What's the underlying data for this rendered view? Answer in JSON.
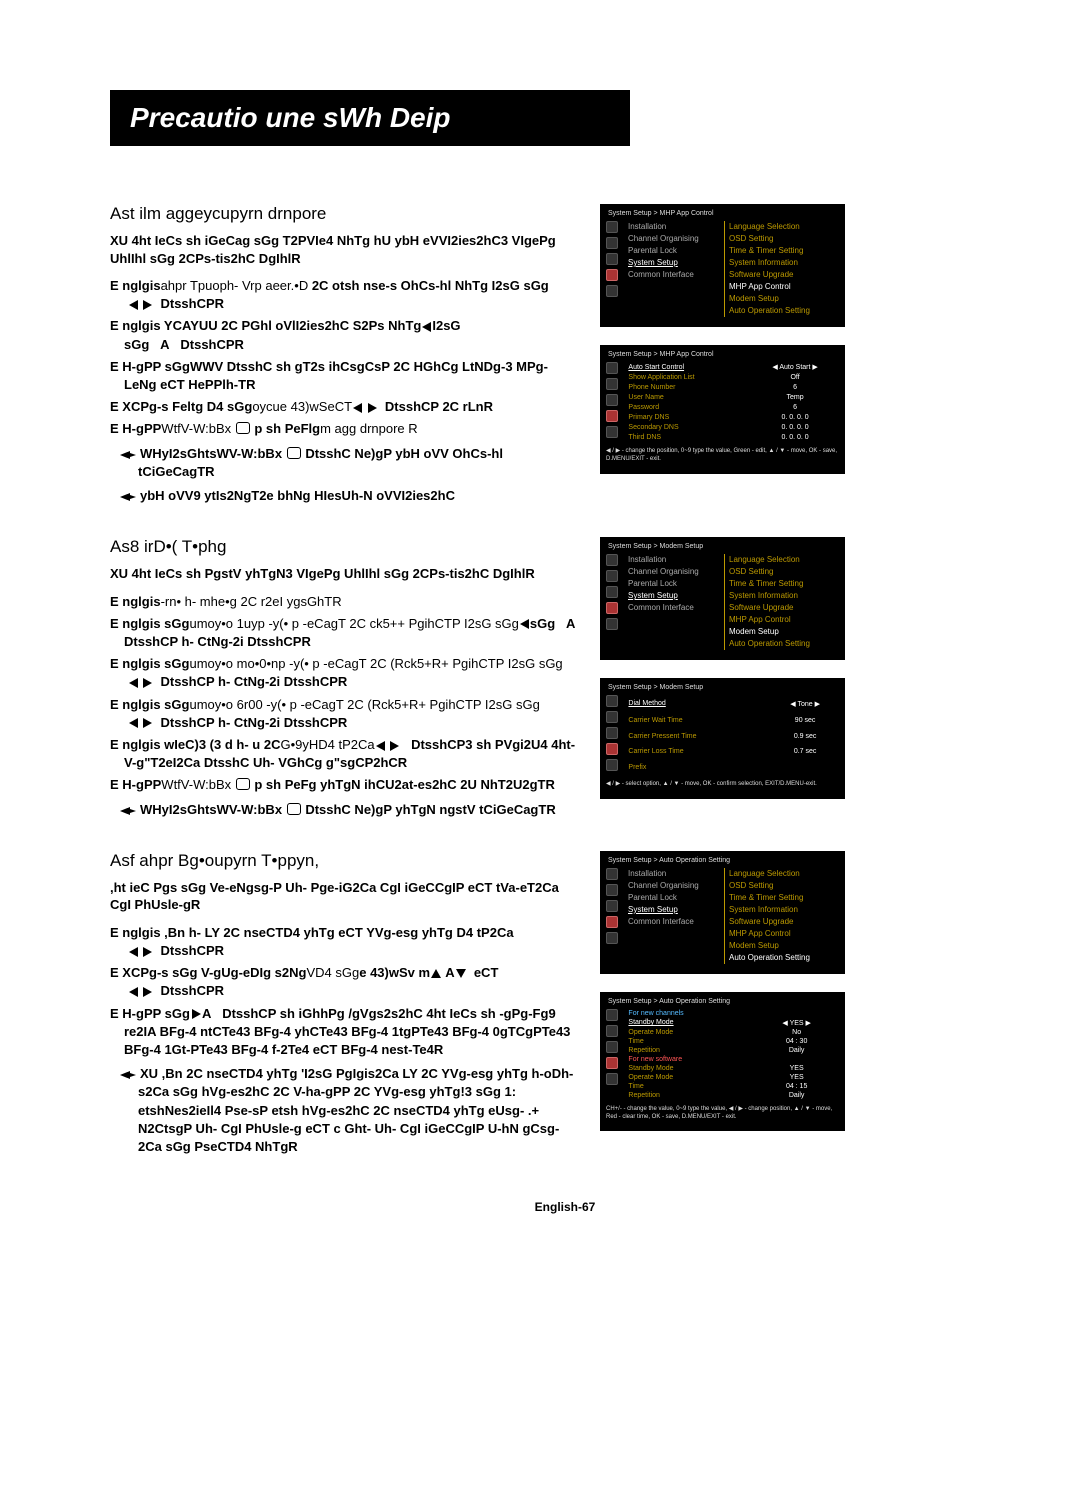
{
  "title": "Precautio une sWh Deip",
  "sec1": {
    "head": "Ast ilm aggeycupyrn drnpore",
    "intro": "XU 4ht IeCs sh iGeCag sGg T2PVIe4 NhTg hU ybH eVVI2ies2hC3 VIgePg UhlIhl sGg 2CPs-tis2hC DgIhlR",
    "s1a": "E nglgis",
    "s1b": "ahpr Tpuoph- Vrp aeer.•D ",
    "s1c": "2C otsh nse-s OhCs-hl NhTg I2sG sGg",
    "s1d": "DtsshCPR",
    "s2a": "E nglgis YCAYUU 2C PGhl oVlI2ies2hC S2Ps NhTg",
    "s2b": "I2sG sGg",
    "s2c": "A",
    "s2d": "DtsshCPR",
    "s3": "E H-gPP sGgWWV DtsshC sh gT2s ihCsgCsP 2C HGhCg LtNDg-3 MPg- LeNg eCT HePPlh-TR",
    "s4a": "E XCPg-s Feltg D4 sGg",
    "s4b": "oycue 43)wSeCT",
    "s4c": "DtsshCP 2C rLnR",
    "s5a": "E H-gPP",
    "s5b": "WtfV-W:bBx",
    "s5c": "p sh PeFlg",
    "s5d": "m agg drnpore   R",
    "n1a": "WHy",
    "n1b": "I2sGhtsWV-W:bBx",
    "n1c": "DtsshC Ne)gP ybH oVV OhCs-hl tCiGeCagTR",
    "n2": "ybH  oVV9 ytIs2NgT2e bhNg HIesUh-N oVVI2ies2hC",
    "scr1_bc": "System Setup > MHP App Control",
    "scr2_bc": "System Setup > MHP App Control",
    "scr1_items": [
      "Installation",
      "Channel Organising",
      "Parental Lock",
      "System Setup",
      "Common Interface"
    ],
    "scr1_sub": [
      "Language Selection",
      "OSD Setting",
      "Time & Timer Setting",
      "System Information",
      "Software Upgrade",
      "MHP App Control",
      "Modem Setup",
      "Auto Operation Setting"
    ],
    "scr2_tbl": [
      [
        "Auto Start Control",
        "Auto Start"
      ],
      [
        "Show Application List",
        "Off"
      ],
      [
        "Phone Number",
        "6"
      ],
      [
        "User Name",
        "Temp"
      ],
      [
        "Password",
        "6"
      ],
      [
        "Primary DNS",
        "0. 0. 0. 0"
      ],
      [
        "Secondary DNS",
        "0. 0. 0. 0"
      ],
      [
        "Third DNS",
        "0. 0. 0. 0"
      ]
    ],
    "scr2_hint": "◀ / ▶ - change the position, 0~9 type the value, Green - edit, ▲ / ▼ - move, OK - save, D.MENU/EXIT - exit."
  },
  "sec2": {
    "head": "As8 irD•( T•phg",
    "intro": "XU 4ht IeCs sh PgstV yhTgN3 VIgePg UhlIhl sGg 2CPs-tis2hC DgIhlR",
    "s1a": "E nglgis",
    "s1b": "-rn• h- mhe•g 2C r2eI ygsGhTR",
    "s2a": "E nglgis sGg",
    "s2b": "umoy•o 1uyp -y(• p -eCagT 2C ck5++ PgihCTP I2sG sGg",
    "s2c": "A",
    "s2d": "DtsshCP h- CtNg-2i DtsshCPR",
    "s3a": "E nglgis sGg",
    "s3b": "umoy•o mo•0•np -y(• p -eCagT 2C (Rck5+R+ PgihCTP I2sG sGg",
    "s3c": "DtsshCP h- CtNg-2i DtsshCPR",
    "s4a": "E nglgis sGg",
    "s4b": "umoy•o 6r00 -y(• p -eCagT 2C (Rck5+R+ PgihCTP I2sG sGg",
    "s4c": "DtsshCP h- CtNg-2i DtsshCPR",
    "s5a": "E nglgis wIeC)3 (3 d h- u 2C",
    "s5b": "G•9yHD4 tP2Ca",
    "s5c": "DtsshCP3 sh PVgi2U4 4ht-V-g\"T2eI2Ca DtsshC Uh- VGhCg g\"sgCP2hCR",
    "s6a": "E H-gPP",
    "s6b": "WtfV-W:bBx",
    "s6c": "p sh PeFg yhTgN ihCU2at-es2hC 2U NhT2U2gTR",
    "n1a": "WHy",
    "n1b": "I2sGhtsWV-W:bBx",
    "n1c": "DtsshC Ne)gP yhTgN ngstV tCiGeCagTR",
    "scr1_bc": "System Setup > Modem Setup",
    "scr2_bc": "System Setup > Modem Setup",
    "scr2_tbl": [
      [
        "Dial Method",
        "Tone"
      ],
      [
        "Carrier Wait Time",
        "90 sec"
      ],
      [
        "Carrier Pressent Time",
        "0.9 sec"
      ],
      [
        "Carrier Loss Time",
        "0.7 sec"
      ],
      [
        "Prefix",
        ""
      ]
    ],
    "scr2_hint": "◀ / ▶ - select option, ▲ / ▼ - move, OK - confirm selection, EXIT/D.MENU-exit."
  },
  "sec3": {
    "head": "Asf ahpr Bg•oupyrn T•ppyn,",
    "intro": ",ht ieC Pgs sGg Ve-eNgsg-P Uh- Pge-iG2Ca CgI iGeCCgIP eCT tVa-eT2Ca CgI PhUsle-gR",
    "s1a": "E nglgis ,Bn h- LY 2C nseCTD4 yhTg eCT YVg-esg yhTg D4 tP2Ca",
    "s1b": "DtsshCPR",
    "s2a": "E XCPg-s sGg V-gUg-eDIg s2Ng",
    "s2b": "VD4 sGg",
    "s2c": "e 43)wSv m",
    "s2d": "A",
    "s2e": "eCT",
    "s2f": "DtsshCPR",
    "s3a": "E H-gPP sGg",
    "s3b": "A",
    "s3c": "DtsshCP sh iGhhPg /gVgs2s2hC 4ht IeCs sh -gPg-Fg9 re2IA BFg-4 ntCTe43 BFg-4 yhCTe43 BFg-4 1tgPTe43 BFg-4 0gTCgPTe43 BFg-4 1Gt-PTe43 BFg-4 f-2Te4 eCT BFg-4 nest-Te4R",
    "n1": "XU ,Bn 2C nseCTD4 yhTg 'I2sG PgIgis2Ca LY 2C YVg-esg yhTg h-oDh-s2Ca sGg hVg-es2hC 2C V-ha-gPP 2C YVg-esg yhTg!3 sGg 1: etshNes2ieIl4 Pse-sP etsh hVg-es2hC 2C nseCTD4 yhTg eUsg- .+ N2CtsgP Uh- CgI PhUsle-g eCT c Ght- Uh- CgI iGeCCgIP U-hN gCsg-2Ca sGg PseCTD4 NhTgR",
    "scr1_bc": "System Setup > Auto Operation Setting",
    "scr2_bc": "System Setup > Auto Operation Setting",
    "scr2_tbl1": [
      [
        "For new channels",
        ""
      ],
      [
        "Standby Mode",
        "YES"
      ],
      [
        "Operate Mode",
        "No"
      ],
      [
        "Time",
        "04 : 30"
      ],
      [
        "Repetition",
        "Daily"
      ]
    ],
    "scr2_tbl2": [
      [
        "For new software",
        ""
      ],
      [
        "Standby Mode",
        "YES"
      ],
      [
        "Operate Mode",
        "YES"
      ],
      [
        "Time",
        "04 : 15"
      ],
      [
        "Repetition",
        "Daily"
      ]
    ],
    "scr2_hint": "CH+/- - change the value, 0~9 type the value, ◀ / ▶ - change position, ▲ / ▼ - move, Red - clear time, OK - save, D.MENU/EXIT - exit."
  },
  "footer": "English-67"
}
